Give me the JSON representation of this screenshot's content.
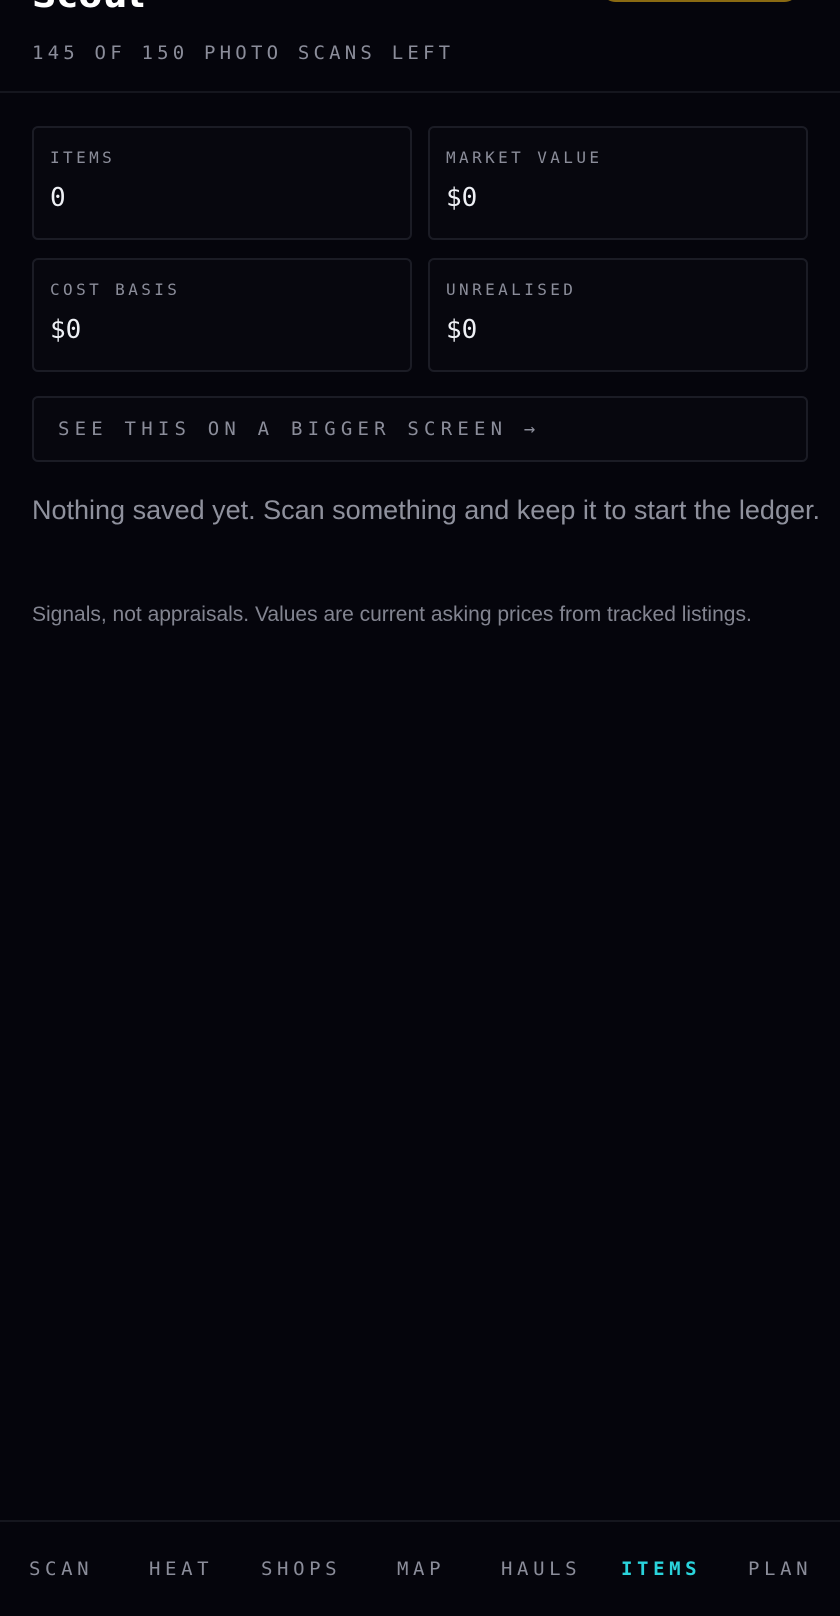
{
  "header": {
    "brand": "Scout",
    "scans_left": "145 OF 150 PHOTO SCANS LEFT"
  },
  "stats": {
    "items": {
      "label": "ITEMS",
      "value": "0"
    },
    "market_value": {
      "label": "MARKET VALUE",
      "value": "$0"
    },
    "cost_basis": {
      "label": "COST BASIS",
      "value": "$0"
    },
    "unrealised": {
      "label": "UNREALISED",
      "value": "$0"
    }
  },
  "bigger_screen_label": "SEE THIS ON A BIGGER SCREEN →",
  "empty_message": "Nothing saved yet. Scan something and keep it to start the ledger.",
  "disclaimer": "Signals, not appraisals. Values are current asking prices from tracked listings.",
  "nav": {
    "items": [
      "SCAN",
      "HEAT",
      "SHOPS",
      "MAP",
      "HAULS",
      "ITEMS",
      "PLAN"
    ],
    "active": "ITEMS"
  },
  "colors": {
    "background": "#05050c",
    "accent_active": "#2ad4dc",
    "header_pill_border": "#8a6a12"
  }
}
